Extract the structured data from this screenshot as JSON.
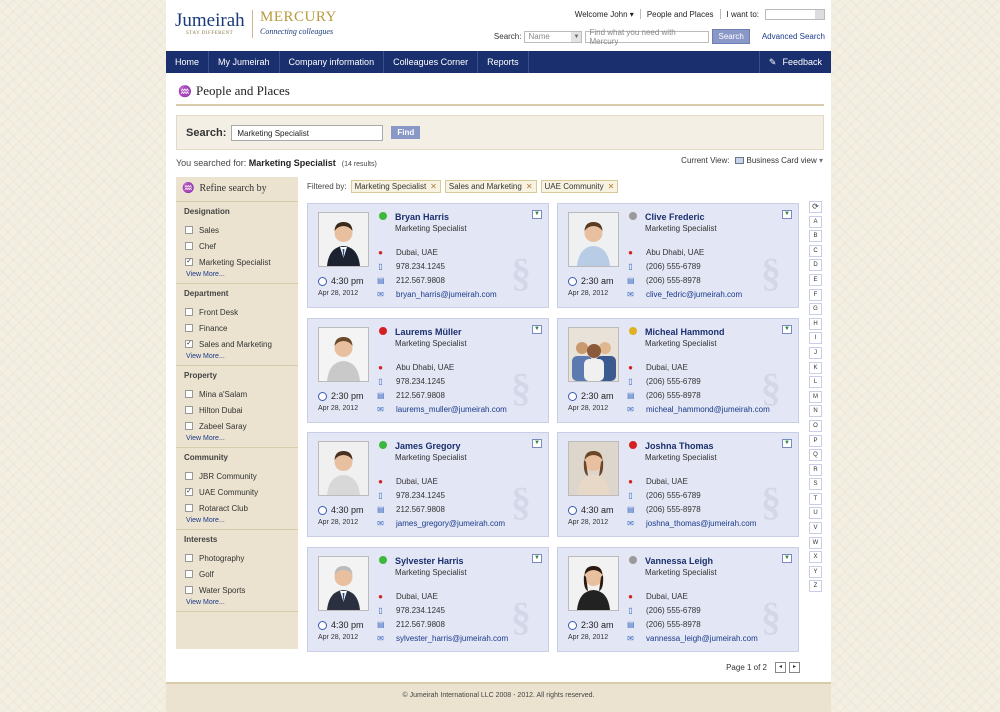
{
  "brand": {
    "name": "Jumeirah",
    "tagline": "STAY DIFFERENT",
    "product": "MERCURY",
    "product_tagline": "Connecting colleagues"
  },
  "top_links": {
    "welcome": "Welcome John",
    "people_places": "People and Places",
    "i_want_to": "I want to:"
  },
  "top_search": {
    "label": "Search:",
    "scope": "Name",
    "placeholder": "Find what you need with Mercury",
    "button": "Search",
    "advanced": "Advanced Search"
  },
  "nav": {
    "items": [
      "Home",
      "My Jumeirah",
      "Company information",
      "Colleagues Corner",
      "Reports"
    ],
    "feedback": "Feedback"
  },
  "page_title": "People and Places",
  "search": {
    "label": "Search:",
    "value": "Marketing Specialist",
    "button": "Find"
  },
  "results": {
    "prefix": "You searched for:",
    "query": "Marketing Specialist",
    "count": "(14 results)"
  },
  "current_view": {
    "label": "Current View:",
    "value": "Business Card view"
  },
  "refine": {
    "title": "Refine search by",
    "groups": [
      {
        "title": "Designation",
        "options": [
          {
            "label": "Sales",
            "checked": false
          },
          {
            "label": "Chef",
            "checked": false
          },
          {
            "label": "Marketing Specialist",
            "checked": true
          }
        ],
        "more": "View More..."
      },
      {
        "title": "Department",
        "options": [
          {
            "label": "Front Desk",
            "checked": false
          },
          {
            "label": "Finance",
            "checked": false
          },
          {
            "label": "Sales and Marketing",
            "checked": true
          }
        ],
        "more": "View More..."
      },
      {
        "title": "Property",
        "options": [
          {
            "label": "Mina a'Salam",
            "checked": false
          },
          {
            "label": "Hilton Dubai",
            "checked": false
          },
          {
            "label": "Zabeel Saray",
            "checked": false
          }
        ],
        "more": "View More..."
      },
      {
        "title": "Community",
        "options": [
          {
            "label": "JBR Community",
            "checked": false
          },
          {
            "label": "UAE Community",
            "checked": true
          },
          {
            "label": "Rotaract Club",
            "checked": false
          }
        ],
        "more": "View More..."
      },
      {
        "title": "Interests",
        "options": [
          {
            "label": "Photography",
            "checked": false
          },
          {
            "label": "Golf",
            "checked": false
          },
          {
            "label": "Water Sports",
            "checked": false
          }
        ],
        "more": "View More..."
      }
    ]
  },
  "filters": {
    "label": "Filtered by:",
    "chips": [
      "Marketing Specialist",
      "Sales and Marketing",
      "UAE Community"
    ]
  },
  "cards": [
    {
      "name": "Bryan Harris",
      "role": "Marketing Specialist",
      "status_color": "#3cb83c",
      "location": "Dubai, UAE",
      "phone": "978.234.1245",
      "mobile": "212.567.9808",
      "email": "bryan_harris@jumeirah.com",
      "time": "4:30 pm",
      "date": "Apr 28, 2012",
      "photo": "suit-dark"
    },
    {
      "name": "Clive Frederic",
      "role": "Marketing Specialist",
      "status_color": "#9a9a9a",
      "location": "Abu Dhabi, UAE",
      "phone": "(206) 555-6789",
      "mobile": "(206) 555-8978",
      "email": "clive_fedric@jumeirah.com",
      "time": "2:30 am",
      "date": "Apr 28, 2012",
      "photo": "shirt-blue"
    },
    {
      "name": "Laurems Müller",
      "role": "Marketing Specialist",
      "status_color": "#d42020",
      "location": "Abu Dhabi, UAE",
      "phone": "978.234.1245",
      "mobile": "212.567.9808",
      "email": "laurems_muller@jumeirah.com",
      "time": "2:30 pm",
      "date": "Apr 28, 2012",
      "photo": "shirt-grey"
    },
    {
      "name": "Micheal Hammond",
      "role": "Marketing Specialist",
      "status_color": "#e0b020",
      "location": "Dubai, UAE",
      "phone": "(206) 555-6789",
      "mobile": "(206) 555-8978",
      "email": "micheal_hammond@jumeirah.com",
      "time": "2:30 am",
      "date": "Apr 28, 2012",
      "photo": "group"
    },
    {
      "name": "James Gregory",
      "role": "Marketing Specialist",
      "status_color": "#3cb83c",
      "location": "Dubai, UAE",
      "phone": "978.234.1245",
      "mobile": "212.567.9808",
      "email": "james_gregory@jumeirah.com",
      "time": "4:30 pm",
      "date": "Apr 28, 2012",
      "photo": "casual"
    },
    {
      "name": "Joshna Thomas",
      "role": "Marketing Specialist",
      "status_color": "#d42020",
      "location": "Dubai, UAE",
      "phone": "(206) 555-6789",
      "mobile": "(206) 555-8978",
      "email": "joshna_thomas@jumeirah.com",
      "time": "4:30 am",
      "date": "Apr 28, 2012",
      "photo": "woman-light"
    },
    {
      "name": "Sylvester Harris",
      "role": "Marketing Specialist",
      "status_color": "#3cb83c",
      "location": "Dubai, UAE",
      "phone": "978.234.1245",
      "mobile": "212.567.9808",
      "email": "sylvester_harris@jumeirah.com",
      "time": "4:30 pm",
      "date": "Apr 28, 2012",
      "photo": "older"
    },
    {
      "name": "Vannessa Leigh",
      "role": "Marketing Specialist",
      "status_color": "#9a9a9a",
      "location": "Dubai, UAE",
      "phone": "(206) 555-6789",
      "mobile": "(206) 555-8978",
      "email": "vannessa_leigh@jumeirah.com",
      "time": "2:30 am",
      "date": "Apr 28, 2012",
      "photo": "woman-dark"
    }
  ],
  "alphabet": [
    "A",
    "B",
    "C",
    "D",
    "E",
    "F",
    "G",
    "H",
    "I",
    "J",
    "K",
    "L",
    "M",
    "N",
    "O",
    "P",
    "Q",
    "R",
    "S",
    "T",
    "U",
    "V",
    "W",
    "X",
    "Y",
    "Z"
  ],
  "pager": {
    "text": "Page 1 of 2"
  },
  "footer": "© Jumeirah International LLC 2008 - 2012. All rights reserved."
}
